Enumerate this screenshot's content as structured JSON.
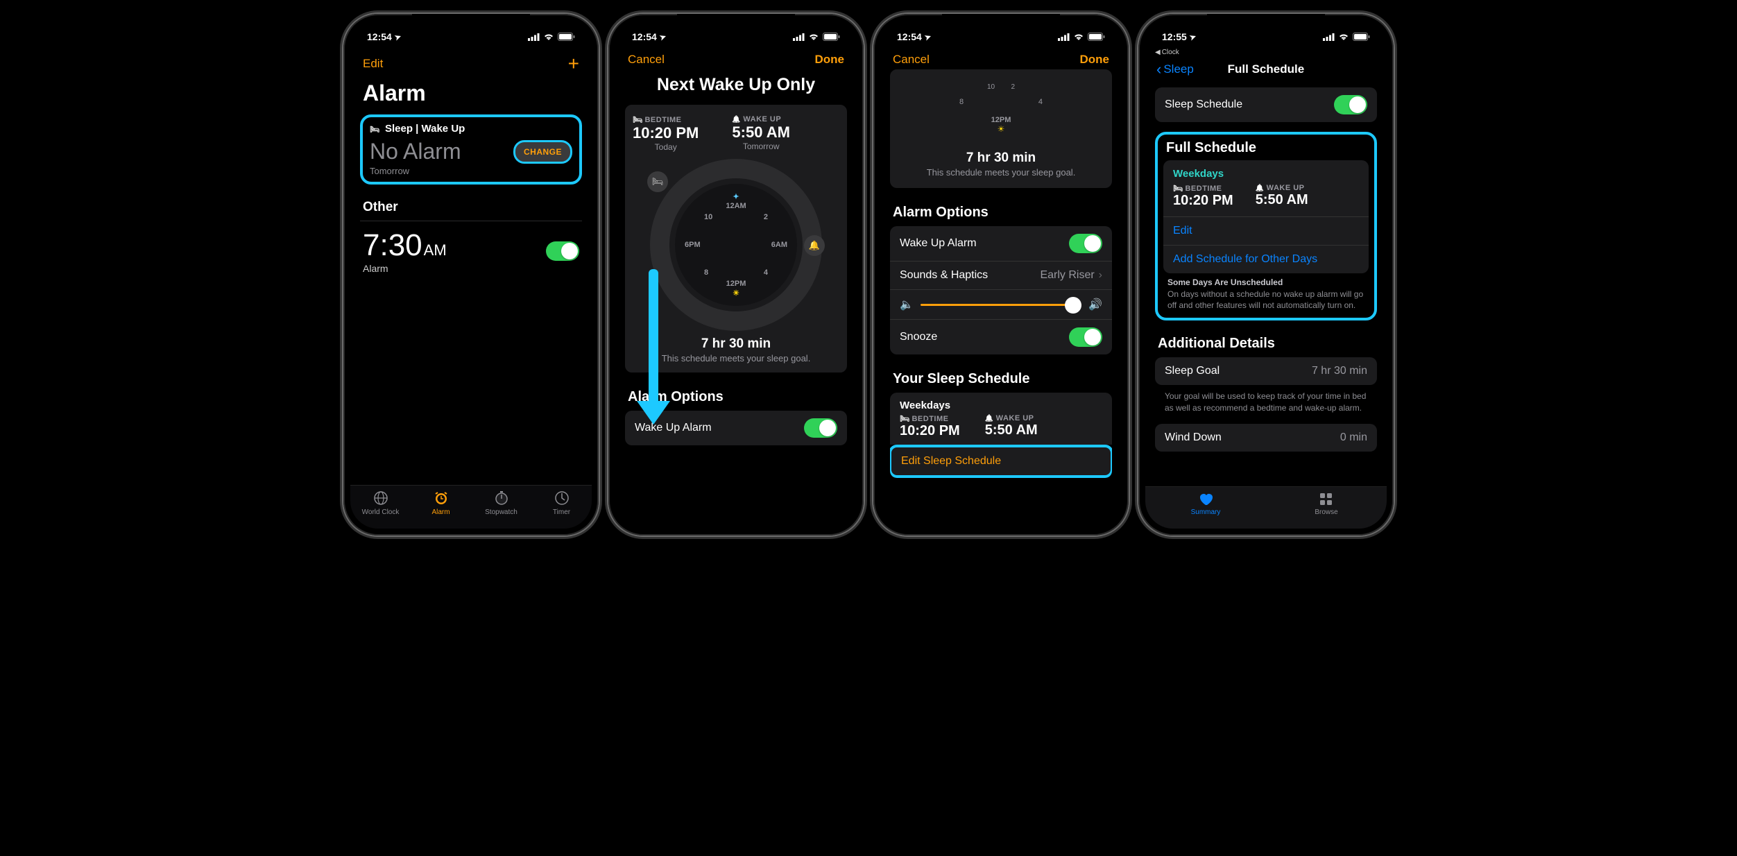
{
  "status": {
    "time1": "12:54",
    "time2": "12:55",
    "locArrow": "➤"
  },
  "p1": {
    "edit": "Edit",
    "title": "Alarm",
    "sleep_label": "Sleep | Wake Up",
    "no_alarm": "No Alarm",
    "tomorrow": "Tomorrow",
    "change": "CHANGE",
    "other": "Other",
    "other_time": "7:30",
    "other_ampm": "AM",
    "other_label": "Alarm",
    "tabs": [
      "World Clock",
      "Alarm",
      "Stopwatch",
      "Timer"
    ]
  },
  "p2": {
    "cancel": "Cancel",
    "done": "Done",
    "title": "Next Wake Up Only",
    "bedtime_lbl": "BEDTIME",
    "bedtime": "10:20 PM",
    "bedtime_sub": "Today",
    "wake_lbl": "WAKE UP",
    "wake": "5:50 AM",
    "wake_sub": "Tomorrow",
    "dial": {
      "top": "12AM",
      "bottom": "12PM",
      "left": "6PM",
      "right": "6AM"
    },
    "dur": "7 hr 30 min",
    "dur_sub": "This schedule meets your sleep goal.",
    "ao_hdr": "Alarm Options",
    "wakeup_alarm": "Wake Up Alarm"
  },
  "p3": {
    "cancel": "Cancel",
    "done": "Done",
    "dur": "7 hr 30 min",
    "dur_sub": "This schedule meets your sleep goal.",
    "ao": "Alarm Options",
    "wakeup_alarm": "Wake Up Alarm",
    "sounds": "Sounds & Haptics",
    "sounds_val": "Early Riser",
    "snooze": "Snooze",
    "yss": "Your Sleep Schedule",
    "weekdays": "Weekdays",
    "bedtime_lbl": "BEDTIME",
    "bedtime": "10:20 PM",
    "wake_lbl": "WAKE UP",
    "wake": "5:50 AM",
    "edit_sched": "Edit Sleep Schedule"
  },
  "p4": {
    "back": "Sleep",
    "backapp": "Clock",
    "title": "Full Schedule",
    "sleep_schedule": "Sleep Schedule",
    "fs": "Full Schedule",
    "weekdays": "Weekdays",
    "bedtime_lbl": "BEDTIME",
    "bedtime": "10:20 PM",
    "wake_lbl": "WAKE UP",
    "wake": "5:50 AM",
    "edit": "Edit",
    "add": "Add Schedule for Other Days",
    "unsch_hdr": "Some Days Are Unscheduled",
    "unsch_body": "On days without a schedule no wake up alarm will go off and other features will not automatically turn on.",
    "ad": "Additional Details",
    "sleep_goal": "Sleep Goal",
    "sleep_goal_val": "7 hr 30 min",
    "goal_foot": "Your goal will be used to keep track of your time in bed as well as recommend a bedtime and wake-up alarm.",
    "wind": "Wind Down",
    "wind_val": "0 min",
    "tabs": [
      "Summary",
      "Browse"
    ]
  }
}
